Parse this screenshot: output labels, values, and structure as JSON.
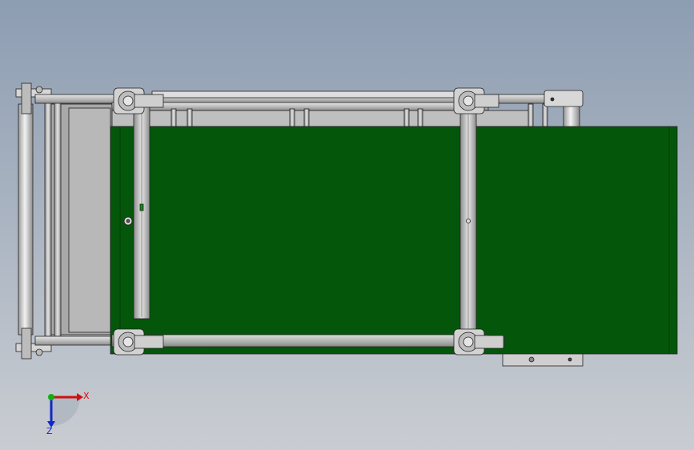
{
  "viewport": {
    "background_top": "#8d9db2",
    "background_bottom": "#c9cdd2"
  },
  "model": {
    "belt_color": "#04570a",
    "belt_edge_color": "#0f6e12",
    "frame_color": "#c9c9c9",
    "frame_dark": "#8a8a8a",
    "roller_color": "#d4d4d4",
    "outline_color": "#222222"
  },
  "triad": {
    "x_label": "X",
    "z_label": "Z",
    "x_color": "#d01010",
    "y_color": "#10b010",
    "z_color": "#1028c8",
    "icons": [
      "x-axis-arrow-icon",
      "y-axis-dot-icon",
      "z-axis-arrow-icon"
    ]
  }
}
